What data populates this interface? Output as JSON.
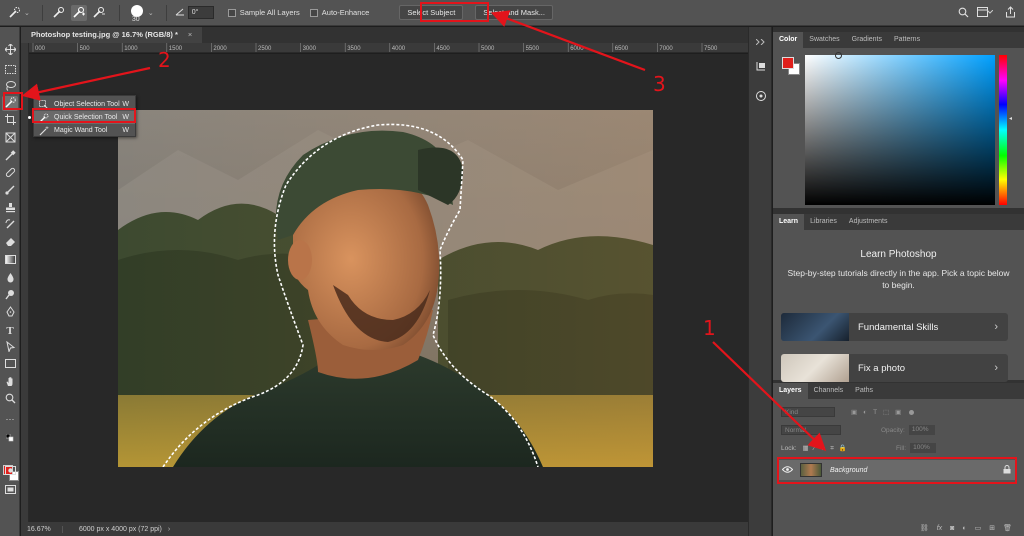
{
  "options_bar": {
    "brush_size": "30",
    "angle": "0°",
    "sample_all_layers": "Sample All Layers",
    "auto_enhance": "Auto-Enhance",
    "select_subject": "Select Subject",
    "select_and_mask": "Select and Mask..."
  },
  "document": {
    "tab_title": "Photoshop testing.jpg @ 16.7% (RGB/8) *",
    "tab_close": "×",
    "zoom": "16.67%",
    "dimensions": "6000 px x 4000 px (72 ppi)",
    "ruler_ticks": [
      "000",
      "500",
      "1000",
      "1500",
      "2000",
      "2500",
      "3000",
      "3500",
      "4000",
      "4500",
      "5000",
      "5500",
      "6000",
      "6500",
      "7000",
      "7500"
    ]
  },
  "flyout": {
    "items": [
      {
        "label": "Object Selection Tool",
        "shortcut": "W"
      },
      {
        "label": "Quick Selection Tool",
        "shortcut": "W"
      },
      {
        "label": "Magic Wand Tool",
        "shortcut": "W"
      }
    ]
  },
  "color_panel": {
    "tabs": [
      "Color",
      "Swatches",
      "Gradients",
      "Patterns"
    ],
    "foreground": "#e0201c",
    "background": "#ffffff"
  },
  "learn_panel": {
    "tabs": [
      "Learn",
      "Libraries",
      "Adjustments"
    ],
    "title": "Learn Photoshop",
    "description": "Step-by-step tutorials directly in the app. Pick a topic below to begin.",
    "cards": [
      {
        "label": "Fundamental Skills"
      },
      {
        "label": "Fix a photo"
      }
    ]
  },
  "layers_panel": {
    "tabs": [
      "Layers",
      "Channels",
      "Paths"
    ],
    "kind": "Kind",
    "blend": "Normal",
    "opacity_label": "Opacity:",
    "opacity_value": "100%",
    "lock_label": "Lock:",
    "fill_label": "Fill:",
    "fill_value": "100%",
    "layer_name": "Background",
    "footer_fx": "fx"
  },
  "annotations": {
    "one": "1",
    "two": "2",
    "three": "3",
    "color": "#e3141b"
  }
}
